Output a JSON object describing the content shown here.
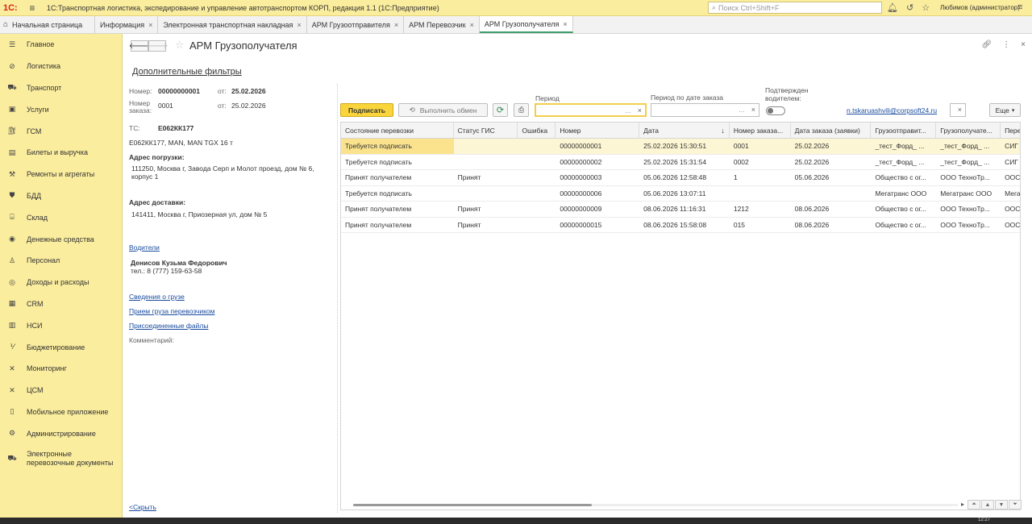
{
  "app": {
    "logo": "1С:",
    "title": "1С:Транспортная логистика, экспедирование и управление автотранспортом КОРП, редакция 1.1  (1С:Предприятие)",
    "search_placeholder": "Поиск Ctrl+Shift+F",
    "user": "Любимов (администратор)"
  },
  "tabs": [
    {
      "label": "Начальная страница",
      "closable": false
    },
    {
      "label": "Информация",
      "closable": true
    },
    {
      "label": "Электронная транспортная накладная",
      "closable": true
    },
    {
      "label": "АРМ Грузоотправителя",
      "closable": true
    },
    {
      "label": "АРМ Перевозчик",
      "closable": true
    },
    {
      "label": "АРМ Грузополучателя",
      "closable": true,
      "active": true
    }
  ],
  "sidebar": {
    "items": [
      {
        "label": "Главное",
        "icon": "menu-icon"
      },
      {
        "label": "Логистика",
        "icon": "logistics-icon"
      },
      {
        "label": "Транспорт",
        "icon": "transport-icon"
      },
      {
        "label": "Услуги",
        "icon": "services-icon"
      },
      {
        "label": "ГСМ",
        "icon": "fuel-icon"
      },
      {
        "label": "Билеты и выручка",
        "icon": "ticket-icon"
      },
      {
        "label": "Ремонты и агрегаты",
        "icon": "repair-icon"
      },
      {
        "label": "БДД",
        "icon": "shield-icon"
      },
      {
        "label": "Склад",
        "icon": "warehouse-icon"
      },
      {
        "label": "Денежные средства",
        "icon": "money-icon"
      },
      {
        "label": "Персонал",
        "icon": "person-icon"
      },
      {
        "label": "Доходы и расходы",
        "icon": "coins-icon"
      },
      {
        "label": "CRM",
        "icon": "crm-icon"
      },
      {
        "label": "НСИ",
        "icon": "book-icon"
      },
      {
        "label": "Бюджетирование",
        "icon": "budget-icon"
      },
      {
        "label": "Мониторинг",
        "icon": "monitor-icon"
      },
      {
        "label": "ЦСМ",
        "icon": "csm-icon"
      },
      {
        "label": "Мобильное приложение",
        "icon": "phone-icon"
      },
      {
        "label": "Администрирование",
        "icon": "gear-icon"
      },
      {
        "label": "Электронные перевозочные документы",
        "icon": "edoc-icon"
      }
    ]
  },
  "page": {
    "title": "АРМ Грузополучателя",
    "additional_filters": "Дополнительные фильтры"
  },
  "details": {
    "number_label": "Номер:",
    "number_value": "00000000001",
    "from_label": "от:",
    "date_value": "25.02.2026",
    "order_label": "Номер заказа:",
    "order_value": "0001",
    "order_from_label": "от:",
    "order_date": "25.02.2026",
    "ts_label": "ТС:",
    "ts_value": "Е062КК177",
    "vehicle": "Е062КК177, MAN, MAN TGX 16 т",
    "loading_label": "Адрес погрузки:",
    "loading_address": "111250, Москва г, Завода Серп и Молот проезд, дом № 6, корпус 1",
    "delivery_label": "Адрес доставки:",
    "delivery_address": "141411, Москва г, Приозерная ул, дом № 5",
    "drivers_link": "Водители",
    "driver_name": "Денисов Кузьма Федорович",
    "driver_phone": "тел.: 8 (777) 159-63-58",
    "cargo_link": "Сведения о грузе",
    "accept_link": "Прием груза перевозчиком",
    "files_link": "Присоединенные файлы",
    "comment_label": "Комментарий:",
    "hide_link": "<Скрыть"
  },
  "toolbar": {
    "sign": "Подписать",
    "exchange": "Выполнить обмен",
    "period_label": "Период",
    "period_order_label": "Период по дате заказа",
    "driver_confirmed_label": "Подтвержден водителем:",
    "email": "n.tskaruashvili@corpsoft24.ru",
    "more": "Еще"
  },
  "table": {
    "columns": [
      "Состояние перевозки",
      "Статус ГИС",
      "Ошибка",
      "Номер",
      "Дата",
      "Номер заказа...",
      "Дата заказа (заявки)",
      "Грузоотправит...",
      "Грузополучате...",
      "Пере"
    ],
    "rows": [
      [
        "Требуется подписать",
        "",
        "",
        "00000000001",
        "25.02.2026 15:30:51",
        "0001",
        "25.02.2026",
        "_тест_Форд_ ...",
        "_тест_Форд_ ...",
        "СИГ"
      ],
      [
        "Требуется подписать",
        "",
        "",
        "00000000002",
        "25.02.2026 15:31:54",
        "0002",
        "25.02.2026",
        "_тест_Форд_ ...",
        "_тест_Форд_ ...",
        "СИГ"
      ],
      [
        "Принят получателем",
        "Принят",
        "",
        "00000000003",
        "05.06.2026 12:58:48",
        "1",
        "05.06.2026",
        "Общество с ог...",
        "ООО ТехноТр...",
        "ООС"
      ],
      [
        "Требуется подписать",
        "",
        "",
        "00000000006",
        "05.06.2026 13:07:11",
        "",
        "",
        "Мегатранс ООО",
        "Мегатранс ООО",
        "Мега"
      ],
      [
        "Принят получателем",
        "Принят",
        "",
        "00000000009",
        "08.06.2026 11:16:31",
        "1212",
        "08.06.2026",
        "Общество с ог...",
        "ООО ТехноТр...",
        "ООС"
      ],
      [
        "Принят получателем",
        "Принят",
        "",
        "00000000015",
        "08.06.2026 15:58:08",
        "015",
        "08.06.2026",
        "Общество с ог...",
        "ООО ТехноТр...",
        "ООС"
      ]
    ]
  },
  "taskbar": {
    "clock": "12:27"
  }
}
